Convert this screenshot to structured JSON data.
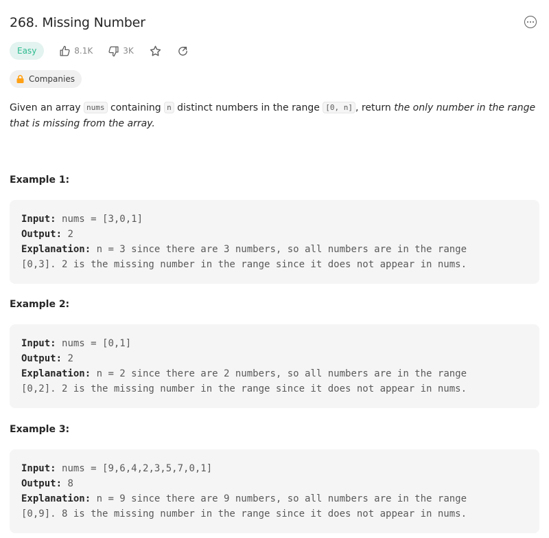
{
  "problem": {
    "title": "268. Missing Number",
    "difficulty": "Easy",
    "likes": "8.1K",
    "dislikes": "3K",
    "companies_label": "Companies"
  },
  "description": {
    "p1": "Given an array ",
    "code_nums": "nums",
    "p2": " containing ",
    "code_n": "n",
    "p3": " distinct numbers in the range ",
    "code_range": "[0, n]",
    "p4": ", return ",
    "p5_em": "the only number in the range that is missing from the array."
  },
  "labels": {
    "input": "Input:",
    "output": "Output:",
    "explanation": "Explanation:"
  },
  "examples": [
    {
      "title": "Example 1:",
      "input": "nums = [3,0,1]",
      "output": "2",
      "explanation_line1": "n = 3 since there are 3 numbers, so all numbers are in the range",
      "explanation_line2": "[0,3]. 2 is the missing number in the range since it does not appear in nums."
    },
    {
      "title": "Example 2:",
      "input": "nums = [0,1]",
      "output": "2",
      "explanation_line1": "n = 2 since there are 2 numbers, so all numbers are in the range",
      "explanation_line2": "[0,2]. 2 is the missing number in the range since it does not appear in nums."
    },
    {
      "title": "Example 3:",
      "input": "nums = [9,6,4,2,3,5,7,0,1]",
      "output": "8",
      "explanation_line1": "n = 9 since there are 9 numbers, so all numbers are in the range",
      "explanation_line2": "[0,9]. 8 is the missing number in the range since it does not appear in nums."
    }
  ],
  "icons": {
    "more": "more-horizontal-icon",
    "like": "thumbs-up-icon",
    "dislike": "thumbs-down-icon",
    "favorite": "star-icon",
    "share": "share-icon",
    "lock": "lock-icon"
  },
  "colors": {
    "easy_text": "#2cbb8f",
    "easy_bg": "#e3f3ef",
    "lock": "#ffa116",
    "code_bg": "#f5f5f5"
  }
}
